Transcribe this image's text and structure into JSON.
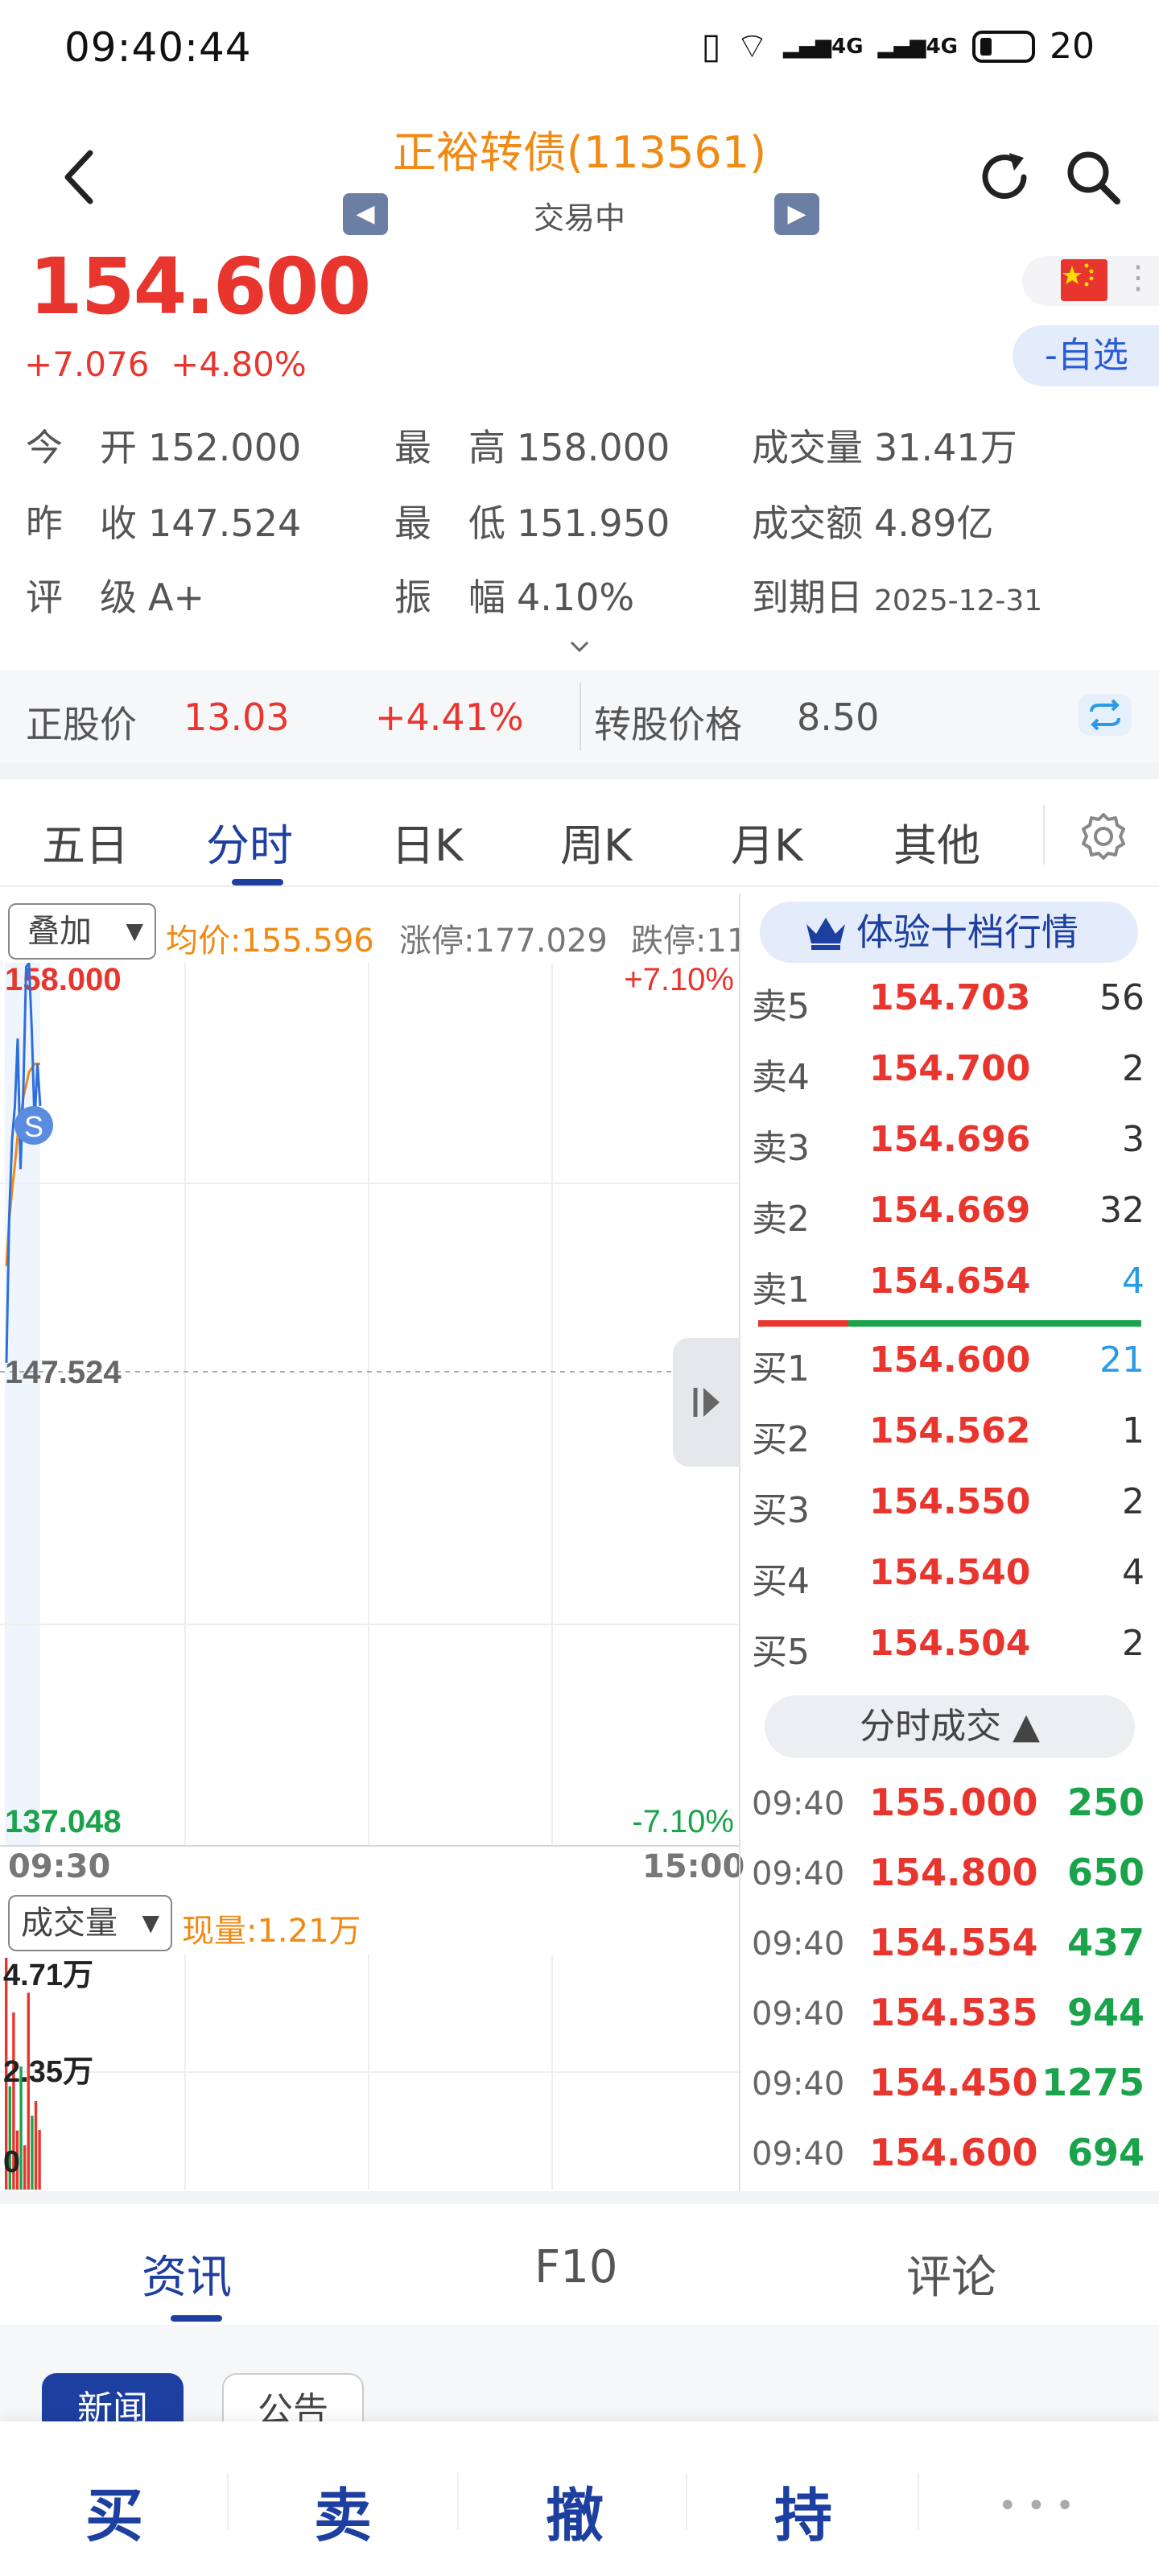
{
  "status_bar": {
    "time": "09:40:44",
    "battery": "20",
    "network_left": "4G",
    "network_right": "4G"
  },
  "header": {
    "title": "正裕转债(113561)",
    "subtitle": "交易中"
  },
  "quote": {
    "price": "154.600",
    "change": "+7.076",
    "change_pct": "+4.80%",
    "watch_label": "-自选",
    "flag": "china-flag-icon",
    "more": "⋮"
  },
  "info": [
    [
      {
        "label": "今　开",
        "value": "152.000"
      },
      {
        "label": "最　高",
        "value": "158.000"
      },
      {
        "label": "成交量",
        "value": "31.41万"
      }
    ],
    [
      {
        "label": "昨　收",
        "value": "147.524"
      },
      {
        "label": "最　低",
        "value": "151.950"
      },
      {
        "label": "成交额",
        "value": "4.89亿"
      }
    ],
    [
      {
        "label": "评　级",
        "value": "A+"
      },
      {
        "label": "振　幅",
        "value": "4.10%"
      },
      {
        "label": "到期日",
        "value": "2025-12-31"
      }
    ]
  ],
  "stock": {
    "label": "正股价",
    "price": "13.03",
    "pct": "+4.41%",
    "conv_label": "转股价格",
    "conv_price": "8.50"
  },
  "tabs": [
    "五日",
    "分时",
    "日K",
    "周K",
    "月K",
    "其他"
  ],
  "active_tab": 1,
  "chart": {
    "overlay_label": "叠加",
    "avg_price": "均价:155.596",
    "limit_up": "涨停:177.029",
    "limit_down": "跌停:11",
    "y_max": "158.000",
    "y_mid": "147.524",
    "y_min": "137.048",
    "pct_max": "+7.10%",
    "pct_min": "-7.10%",
    "time_start": "09:30",
    "time_end": "15:00",
    "marker": "S",
    "vol_label": "成交量",
    "cur_vol": "现量:1.21万",
    "vol_max": "4.71万",
    "vol_mid": "2.35万",
    "vol_min": "0"
  },
  "chart_data": {
    "type": "line",
    "y_range": [
      137.048,
      158.0
    ],
    "price_series": [
      148.5,
      152.0,
      153.8,
      154.6,
      156.2,
      153.1,
      155.0,
      157.9,
      158.0,
      156.4,
      154.2,
      155.6,
      154.6
    ],
    "avg_series": [
      150.8,
      151.9,
      152.6,
      153.2,
      153.9,
      154.3,
      154.8,
      155.1,
      155.4,
      155.5,
      155.6,
      155.6,
      155.6
    ],
    "volume_max": 47100,
    "volume_series": [
      47100,
      21000,
      36000,
      12000,
      25000,
      9000,
      40000,
      15000,
      18000,
      12100
    ]
  },
  "order_book": {
    "button_label": "体验十档行情",
    "asks": [
      {
        "side": "卖5",
        "price": "154.703",
        "vol": "56"
      },
      {
        "side": "卖4",
        "price": "154.700",
        "vol": "2"
      },
      {
        "side": "卖3",
        "price": "154.696",
        "vol": "3"
      },
      {
        "side": "卖2",
        "price": "154.669",
        "vol": "32"
      },
      {
        "side": "卖1",
        "price": "154.654",
        "vol": "4"
      }
    ],
    "bids": [
      {
        "side": "买1",
        "price": "154.600",
        "vol": "21"
      },
      {
        "side": "买2",
        "price": "154.562",
        "vol": "1"
      },
      {
        "side": "买3",
        "price": "154.550",
        "vol": "2"
      },
      {
        "side": "买4",
        "price": "154.540",
        "vol": "4"
      },
      {
        "side": "买5",
        "price": "154.504",
        "vol": "2"
      }
    ]
  },
  "ticks": {
    "button_label": "分时成交",
    "rows": [
      {
        "time": "09:40",
        "price": "155.000",
        "vol": "250"
      },
      {
        "time": "09:40",
        "price": "154.800",
        "vol": "650"
      },
      {
        "time": "09:40",
        "price": "154.554",
        "vol": "437"
      },
      {
        "time": "09:40",
        "price": "154.535",
        "vol": "944"
      },
      {
        "time": "09:40",
        "price": "154.450",
        "vol": "1275"
      },
      {
        "time": "09:40",
        "price": "154.600",
        "vol": "694"
      }
    ]
  },
  "info_tabs": [
    "资讯",
    "F10",
    "评论"
  ],
  "news_chips": [
    "新闻",
    "公告"
  ],
  "trade": [
    "买",
    "卖",
    "撤",
    "持"
  ],
  "trade_more": "•••",
  "colors": {
    "up": "#e8362f",
    "down": "#1aa34a",
    "accent": "#1d3fa0",
    "orange": "#f08a13"
  }
}
